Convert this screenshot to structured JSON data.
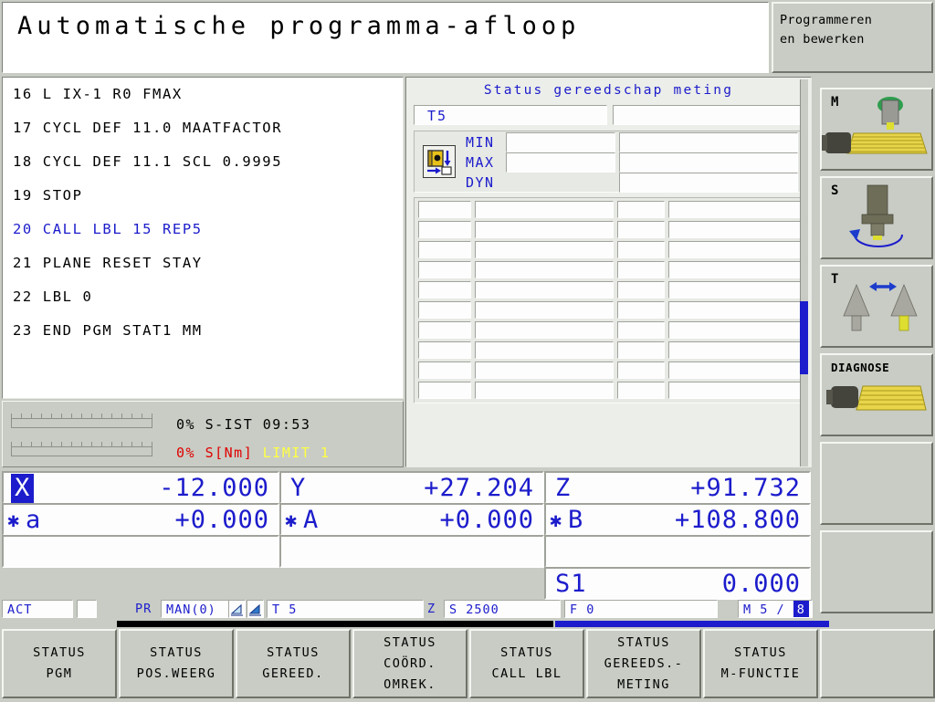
{
  "header": {
    "title": "Automatische programma-afloop",
    "mode_line1": "Programmeren",
    "mode_line2": "en bewerken"
  },
  "program": {
    "lines": [
      {
        "text": "16 L IX-1 R0 FMAX",
        "active": false
      },
      {
        "text": "17 CYCL DEF 11.0 MAATFACTOR",
        "active": false
      },
      {
        "text": "18 CYCL DEF 11.1 SCL 0.9995",
        "active": false
      },
      {
        "text": "19 STOP",
        "active": false
      },
      {
        "text": "20 CALL LBL 15 REP5",
        "active": true
      },
      {
        "text": "21 PLANE RESET STAY",
        "active": false
      },
      {
        "text": "22 LBL 0",
        "active": false
      },
      {
        "text": "23 END PGM STAT1 MM",
        "active": false
      }
    ]
  },
  "load": {
    "row1": "0% S-IST 09:53",
    "row2_pct": "0%",
    "row2_unit": "S[Nm]",
    "row2_limit": "LIMIT 1",
    "color_red": "#e00000",
    "color_yellow": "#ffff44"
  },
  "status_panel": {
    "title": "Status gereedschap meting",
    "tool_name": "T5",
    "tool_name2": "",
    "labels": {
      "min": "MIN",
      "max": "MAX",
      "dyn": "DYN"
    },
    "min_val1": "",
    "min_val2": "",
    "max_val1": "",
    "max_val2": "",
    "dyn_val": "",
    "table_rows": 10,
    "table_cols": 4,
    "accent": "#1c1ccc"
  },
  "vkeys": [
    {
      "label": "M",
      "icon": "machine-m-icon"
    },
    {
      "label": "S",
      "icon": "spindle-s-icon"
    },
    {
      "label": "T",
      "icon": "tool-t-icon"
    },
    {
      "label": "DIAGNOSE",
      "icon": "diagnose-icon"
    },
    {
      "label": "",
      "icon": ""
    },
    {
      "label": "",
      "icon": ""
    }
  ],
  "positions": {
    "row1": [
      {
        "axis": "X",
        "value": "-12.000",
        "highlight": true,
        "star": false
      },
      {
        "axis": "Y",
        "value": "+27.204",
        "highlight": false,
        "star": false
      },
      {
        "axis": "Z",
        "value": "+91.732",
        "highlight": false,
        "star": false
      }
    ],
    "row2": [
      {
        "axis": "a",
        "value": "+0.000",
        "highlight": false,
        "star": true
      },
      {
        "axis": "A",
        "value": "+0.000",
        "highlight": false,
        "star": true
      },
      {
        "axis": "B",
        "value": "+108.800",
        "highlight": false,
        "star": true
      }
    ],
    "row3": [
      {
        "axis": "",
        "value": "",
        "highlight": false,
        "star": false
      },
      {
        "axis": "",
        "value": "",
        "highlight": false,
        "star": false
      },
      {
        "axis": "",
        "value": "",
        "highlight": false,
        "star": false
      }
    ],
    "spindle": {
      "axis": "S1",
      "value": "0.000"
    }
  },
  "statusbar": {
    "act": "ACT",
    "blank": "",
    "pr": "PR",
    "man": "MAN(0)",
    "icon1": "workpiece-angle-icon",
    "icon2": "workpiece-tilt-icon",
    "tool": "T 5",
    "tool_axis": "Z",
    "speed": "S 2500",
    "feed": "F 0",
    "m_prefix": "M 5 /",
    "m_badge": "8"
  },
  "softkeys": [
    {
      "line1": "STATUS",
      "line2": "PGM"
    },
    {
      "line1": "STATUS",
      "line2": "POS.WEERG"
    },
    {
      "line1": "STATUS",
      "line2": "GEREED."
    },
    {
      "line1": "STATUS",
      "line2": "COÖRD.",
      "line3": "OMREK."
    },
    {
      "line1": "STATUS",
      "line2": "CALL LBL"
    },
    {
      "line1": "STATUS",
      "line2": "GEREEDS.-",
      "line3": "METING"
    },
    {
      "line1": "STATUS",
      "line2": "M-FUNCTIE"
    },
    {
      "line1": "",
      "line2": ""
    }
  ]
}
